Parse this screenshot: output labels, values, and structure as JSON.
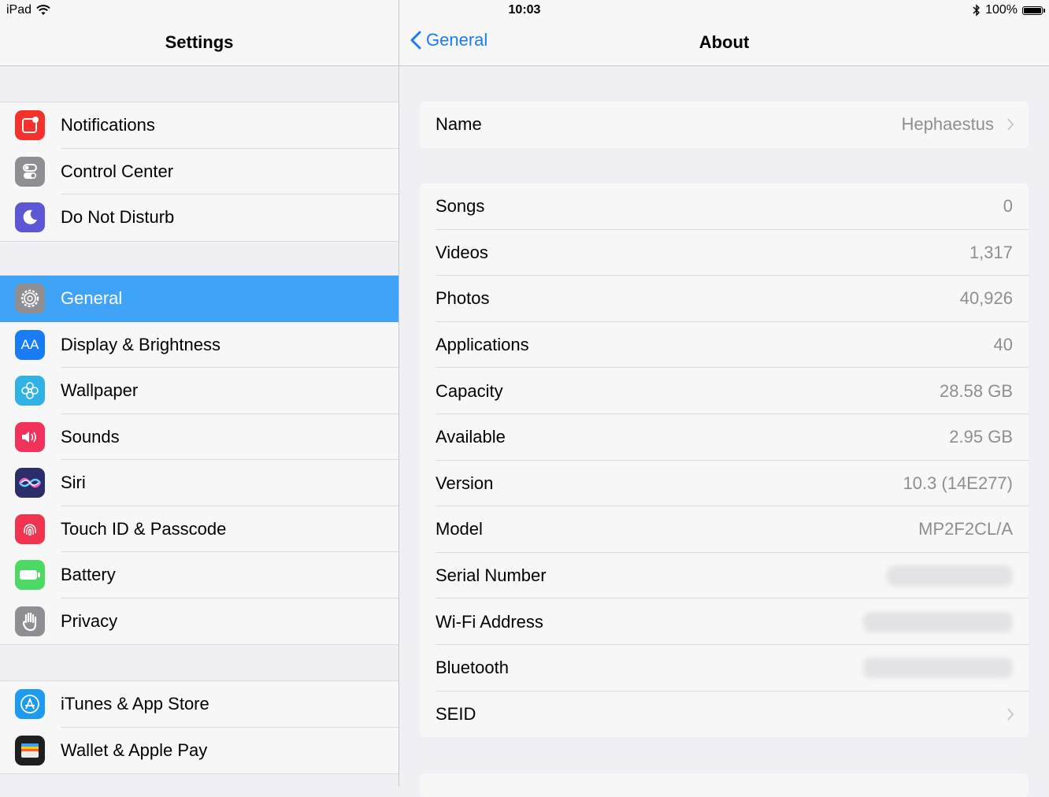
{
  "status": {
    "device": "iPad",
    "time": "10:03",
    "battery": "100%"
  },
  "master": {
    "title": "Settings",
    "groups": [
      [
        {
          "label": "Notifications",
          "icon": "notifications-icon",
          "color": "#f5312d"
        },
        {
          "label": "Control Center",
          "icon": "control-center-icon",
          "color": "#8e8e93"
        },
        {
          "label": "Do Not Disturb",
          "icon": "moon-icon",
          "color": "#5d57d6"
        }
      ],
      [
        {
          "label": "General",
          "icon": "gear-icon",
          "color": "#8e8e93",
          "selected": true
        },
        {
          "label": "Display & Brightness",
          "icon": "display-aa-icon",
          "color": "#1a7cf5"
        },
        {
          "label": "Wallpaper",
          "icon": "wallpaper-flower-icon",
          "color": "#30b3e4"
        },
        {
          "label": "Sounds",
          "icon": "speaker-icon",
          "color": "#f1325a"
        },
        {
          "label": "Siri",
          "icon": "siri-icon",
          "color": "#2c2d6b"
        },
        {
          "label": "Touch ID & Passcode",
          "icon": "fingerprint-icon",
          "color": "#f0334f"
        },
        {
          "label": "Battery",
          "icon": "battery-icon",
          "color": "#4cd964"
        },
        {
          "label": "Privacy",
          "icon": "hand-icon",
          "color": "#8e8e93"
        }
      ],
      [
        {
          "label": "iTunes & App Store",
          "icon": "app-store-icon",
          "color": "#1d9bf0"
        },
        {
          "label": "Wallet & Apple Pay",
          "icon": "wallet-icon",
          "color": "#1f1f1f"
        }
      ]
    ]
  },
  "detail": {
    "back_label": "General",
    "title": "About",
    "name_row": {
      "key": "Name",
      "value": "Hephaestus"
    },
    "rows": [
      {
        "key": "Songs",
        "value": "0"
      },
      {
        "key": "Videos",
        "value": "1,317"
      },
      {
        "key": "Photos",
        "value": "40,926"
      },
      {
        "key": "Applications",
        "value": "40"
      },
      {
        "key": "Capacity",
        "value": "28.58 GB"
      },
      {
        "key": "Available",
        "value": "2.95 GB"
      },
      {
        "key": "Version",
        "value": "10.3 (14E277)"
      },
      {
        "key": "Model",
        "value": "MP2F2CL/A"
      },
      {
        "key": "Serial Number",
        "value": "",
        "blurred": true
      },
      {
        "key": "Wi-Fi Address",
        "value": "",
        "blurred": true
      },
      {
        "key": "Bluetooth",
        "value": "",
        "blurred": true
      },
      {
        "key": "SEID",
        "value": "",
        "chevron": true
      }
    ]
  }
}
